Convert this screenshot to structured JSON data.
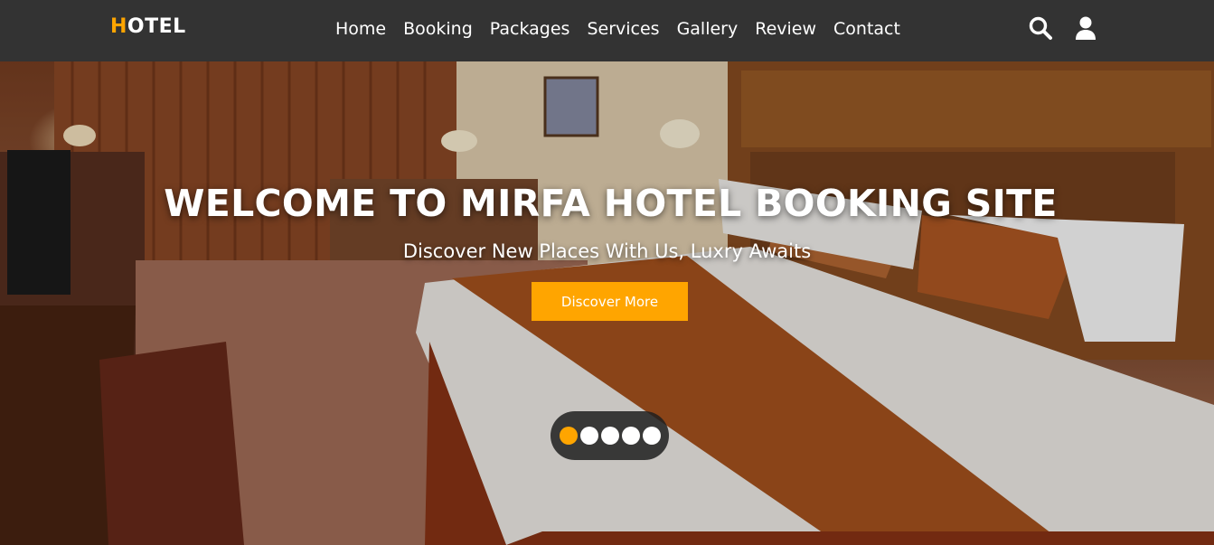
{
  "header": {
    "logo_first": "H",
    "logo_rest": "OTEL",
    "nav": [
      "Home",
      "Booking",
      "Packages",
      "Services",
      "Gallery",
      "Review",
      "Contact"
    ],
    "icons": [
      "search-icon",
      "user-icon"
    ]
  },
  "hero": {
    "title": "WELCOME TO MIRFA HOTEL BOOKING SITE",
    "subtitle": "Discover New Places With Us, Luxry Awaits",
    "cta_label": "Discover More",
    "slides": 5,
    "active_slide": 1
  },
  "colors": {
    "accent": "#ffa500",
    "header_bg": "#333333",
    "text": "#ffffff"
  }
}
